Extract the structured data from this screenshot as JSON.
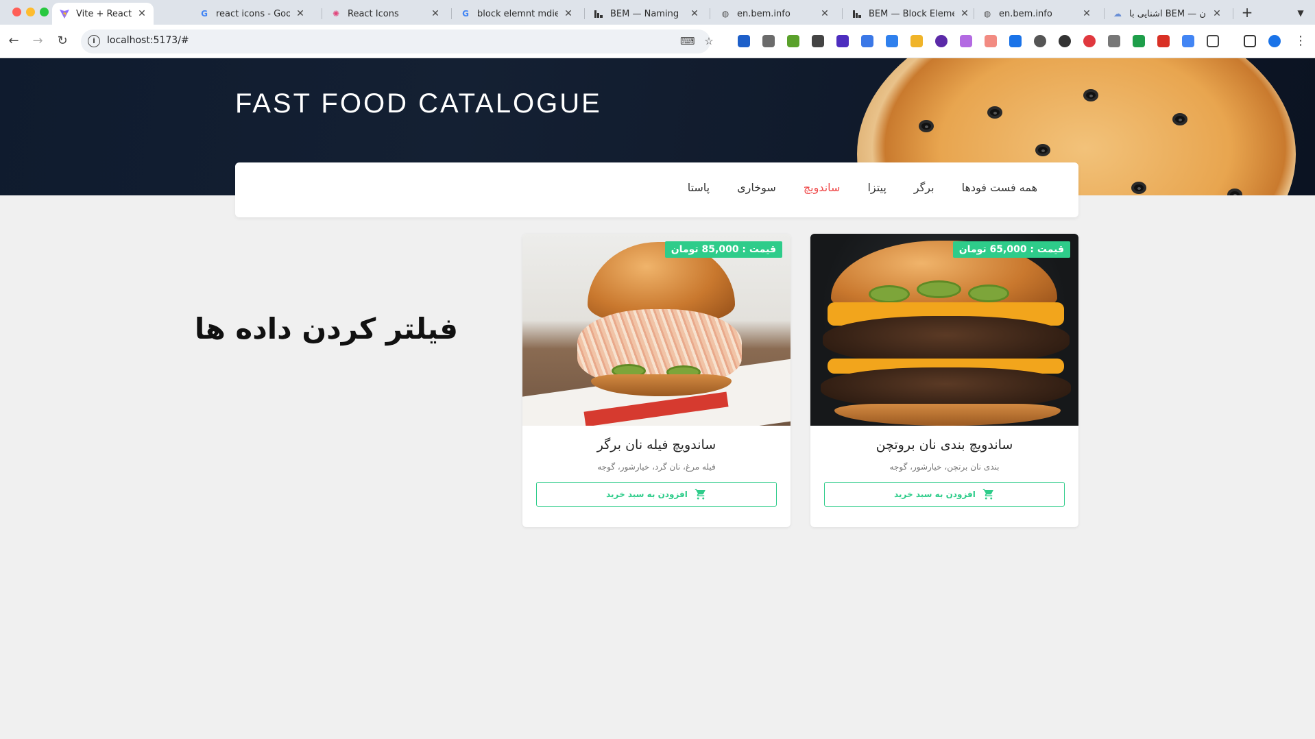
{
  "browser": {
    "tabs": [
      {
        "title": "Vite + React",
        "icon": "vite-icon",
        "active": true
      },
      {
        "title": "react icons - Google",
        "icon": "google-icon",
        "active": false
      },
      {
        "title": "React Icons",
        "icon": "react-icon",
        "active": false
      },
      {
        "title": "block elemnt mdier ب",
        "icon": "google-icon",
        "active": false
      },
      {
        "title": "BEM — Naming",
        "icon": "bem-icon",
        "active": false
      },
      {
        "title": "en.bem.info",
        "icon": "globe-icon",
        "active": false
      },
      {
        "title": "BEM — Block Elemen",
        "icon": "bem-icon",
        "active": false
      },
      {
        "title": "en.bem.info",
        "icon": "globe-icon",
        "active": false
      },
      {
        "title": "آشنایی با BEM — به زبان",
        "icon": "site-icon",
        "active": false
      }
    ],
    "url": "localhost:5173/#"
  },
  "hero": {
    "title": "FAST FOOD CATALOGUE"
  },
  "filters": {
    "items": [
      "همه فست فودها",
      "برگر",
      "پیتزا",
      "ساندویچ",
      "سوخاری",
      "پاستا"
    ],
    "active_index": 3
  },
  "main": {
    "heading": "فیلتر کردن داده ها"
  },
  "products": [
    {
      "name": "ساندویچ بندی نان بروتچن",
      "ingredients": "بندی نان برتچن، خیارشور، گوجه",
      "price_label": "قیمت : 65,000 تومان",
      "button_label": "افزودن به سبد خرید"
    },
    {
      "name": "ساندویچ فیله نان برگر",
      "ingredients": "فیله مرغ، نان گرد، خیارشور، گوجه",
      "price_label": "قیمت : 85,000 تومان",
      "button_label": "افزودن به سبد خرید"
    }
  ],
  "colors": {
    "accent_green": "#2ecc8a",
    "active_filter": "#ef4a4a",
    "hero_bg": "#0f1b2e"
  }
}
